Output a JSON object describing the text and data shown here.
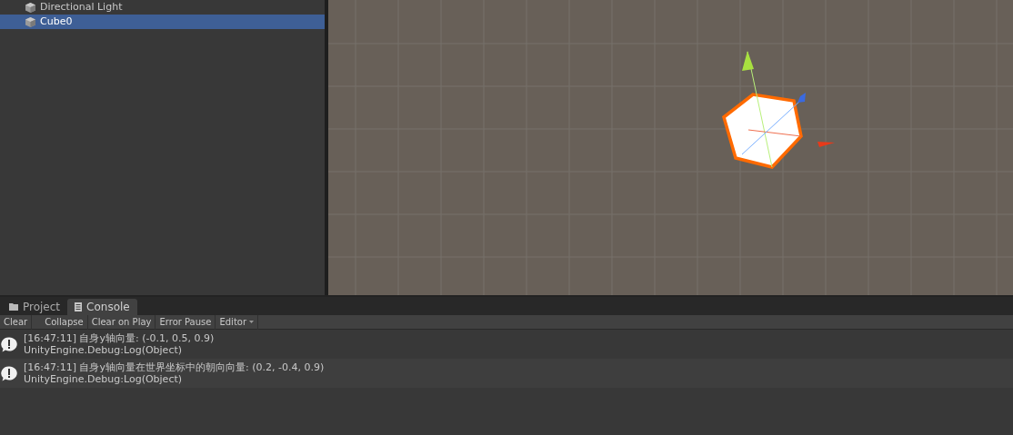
{
  "hierarchy": {
    "items": [
      {
        "label": "Directional Light",
        "selected": false
      },
      {
        "label": "Cube0",
        "selected": true
      }
    ]
  },
  "bottom_tabs": [
    {
      "label": "Project",
      "kind": "folder",
      "selected": false
    },
    {
      "label": "Console",
      "kind": "console",
      "selected": true
    }
  ],
  "console_toolbar": [
    {
      "label": "Clear",
      "kind": "button"
    },
    {
      "label": "Collapse",
      "kind": "toggle"
    },
    {
      "label": "Clear on Play",
      "kind": "toggle"
    },
    {
      "label": "Error Pause",
      "kind": "toggle"
    },
    {
      "label": "Editor",
      "kind": "dropdown"
    }
  ],
  "console_entries": [
    {
      "message": "[16:47:11] 自身y轴向量: (-0.1, 0.5, 0.9)",
      "trace": "UnityEngine.Debug:Log(Object)"
    },
    {
      "message": "[16:47:11] 自身y轴向量在世界坐标中的朝向向量: (0.2, -0.4, 0.9)",
      "trace": "UnityEngine.Debug:Log(Object)"
    }
  ]
}
